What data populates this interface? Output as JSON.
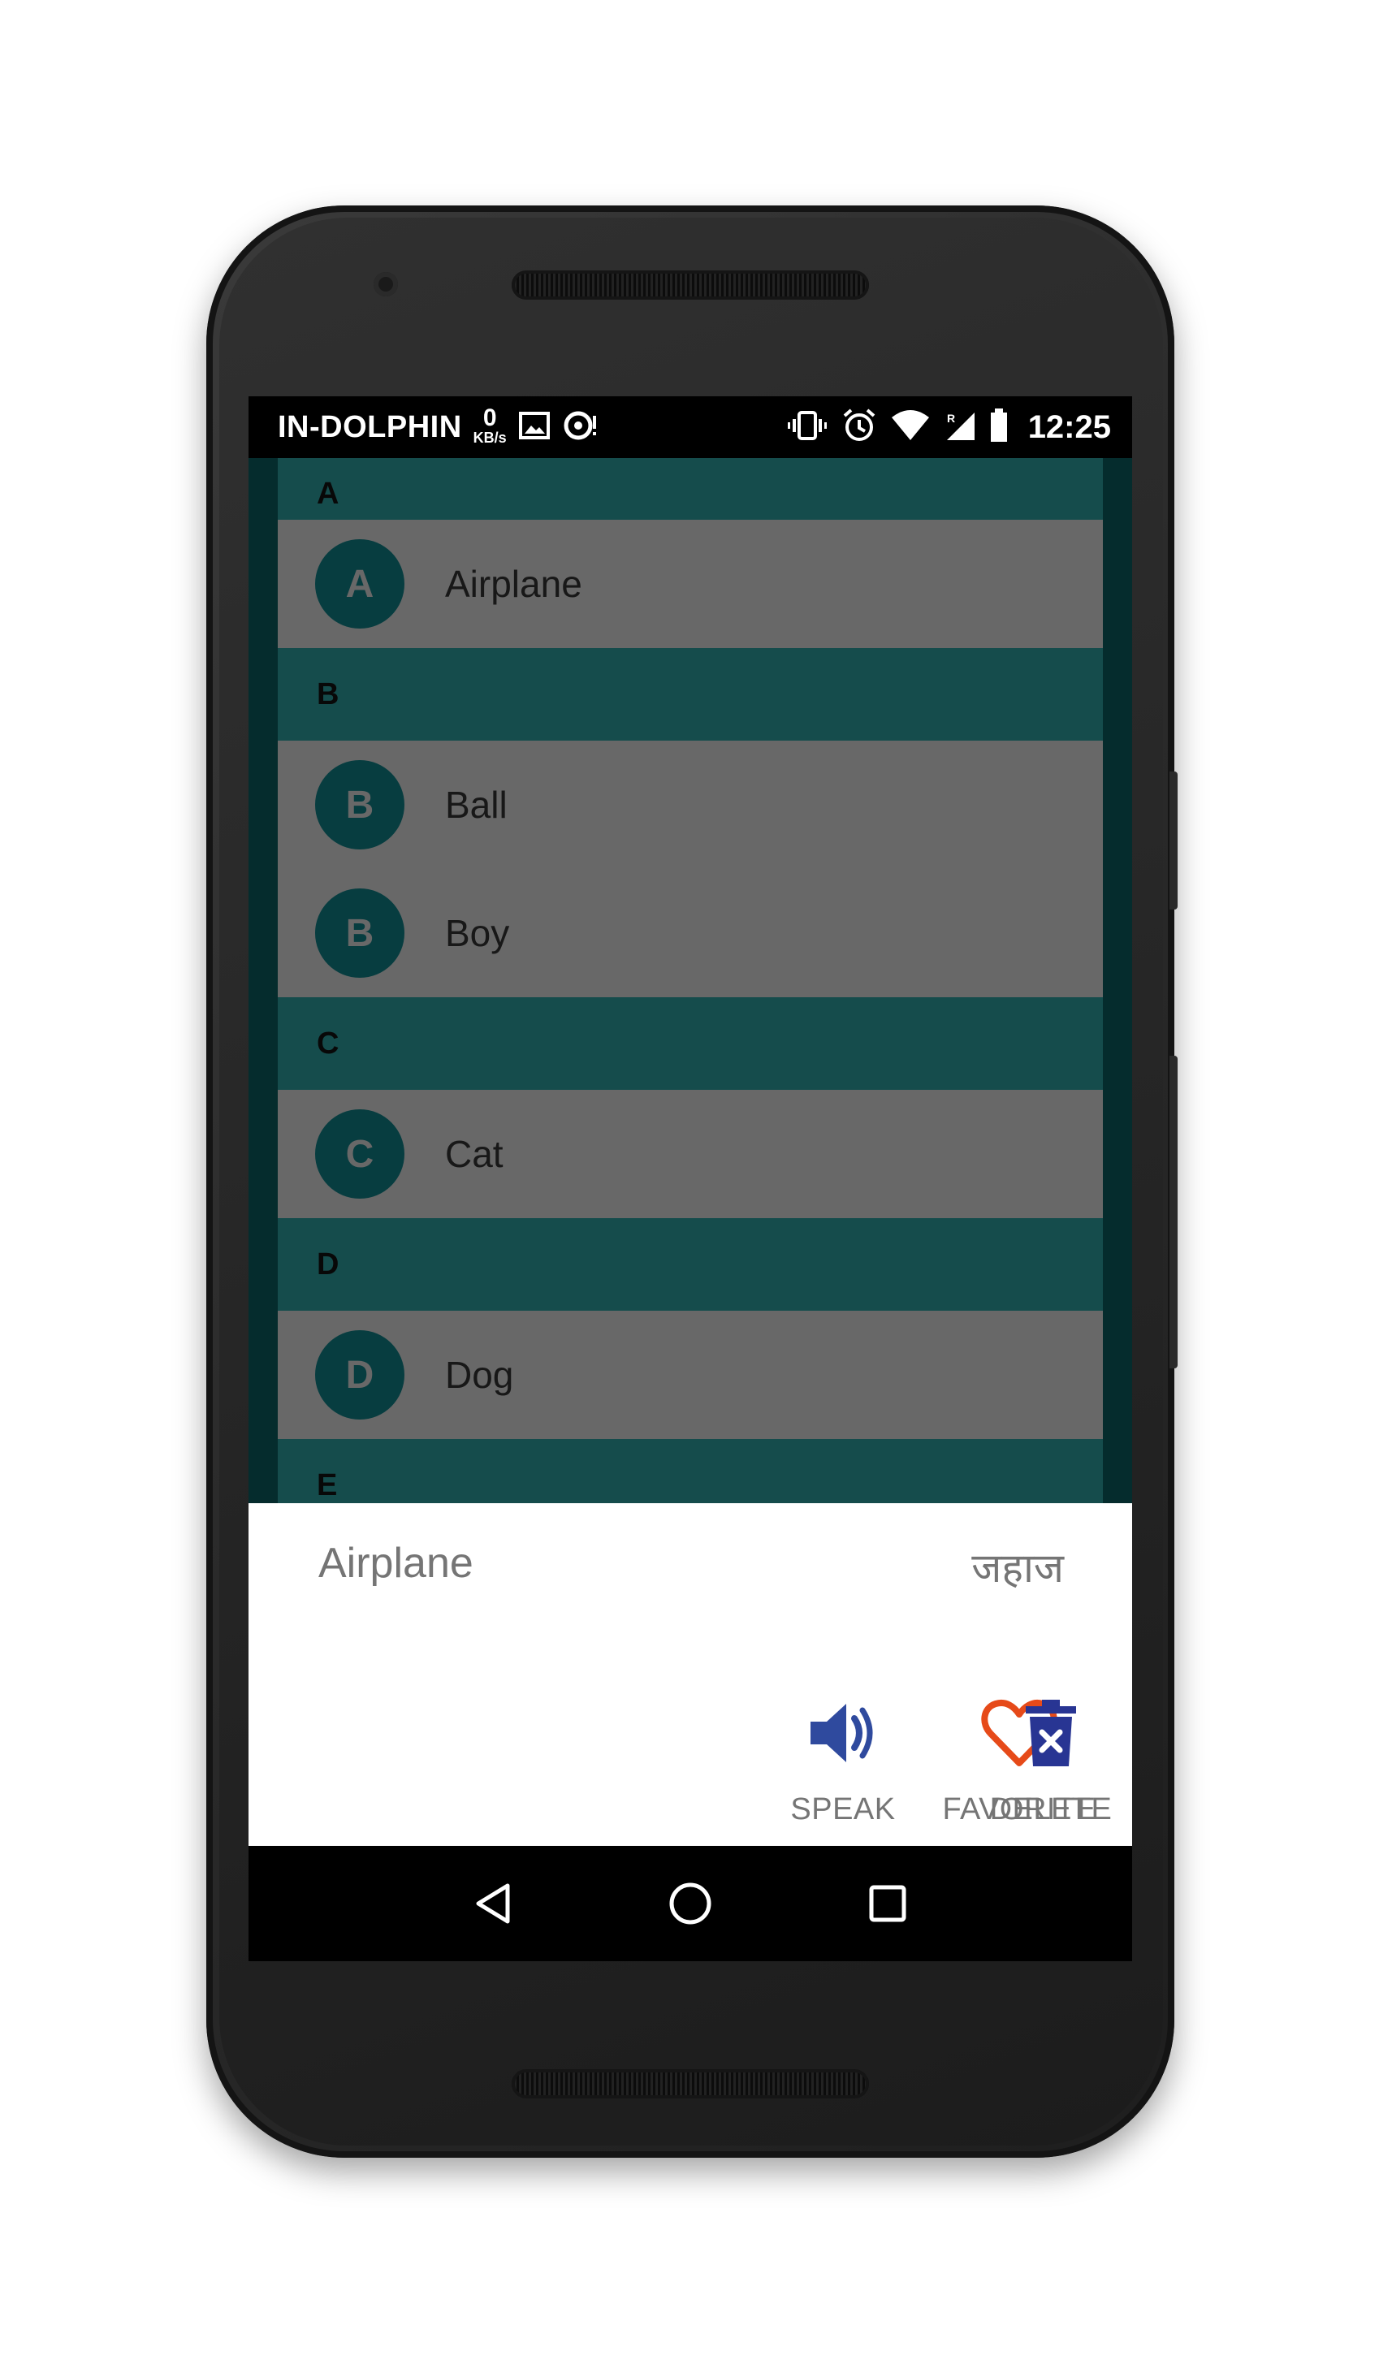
{
  "status_bar": {
    "carrier": "IN-DOLPHIN",
    "speed_value": "0",
    "speed_unit": "KB/s",
    "time": "12:25",
    "icons": [
      "image-icon",
      "sync-icon",
      "vibrate-icon",
      "alarm-icon",
      "wifi-icon",
      "signal-roaming-icon",
      "battery-icon"
    ]
  },
  "list": {
    "sections": [
      {
        "header": "A",
        "items": [
          {
            "letter": "A",
            "word": "Airplane"
          }
        ]
      },
      {
        "header": "B",
        "items": [
          {
            "letter": "B",
            "word": "Ball"
          },
          {
            "letter": "B",
            "word": "Boy"
          }
        ]
      },
      {
        "header": "C",
        "items": [
          {
            "letter": "C",
            "word": "Cat"
          }
        ]
      },
      {
        "header": "D",
        "items": [
          {
            "letter": "D",
            "word": "Dog"
          }
        ]
      },
      {
        "header": "E",
        "items": []
      }
    ]
  },
  "bottom_sheet": {
    "word": "Airplane",
    "translation": "जहाज",
    "actions": {
      "speak": "SPEAK",
      "favorite": "FAVORITE",
      "delete": "DELETE"
    }
  },
  "colors": {
    "teal_dark": "#0b5c5f",
    "section_header": "#2d9f9f",
    "avatar": "#0f7f86",
    "speak_icon": "#2f4a9e",
    "favorite_icon": "#e64a19",
    "delete_icon": "#283593"
  },
  "nav_bar": {
    "icons": [
      "back-icon",
      "home-icon",
      "recents-icon"
    ]
  }
}
